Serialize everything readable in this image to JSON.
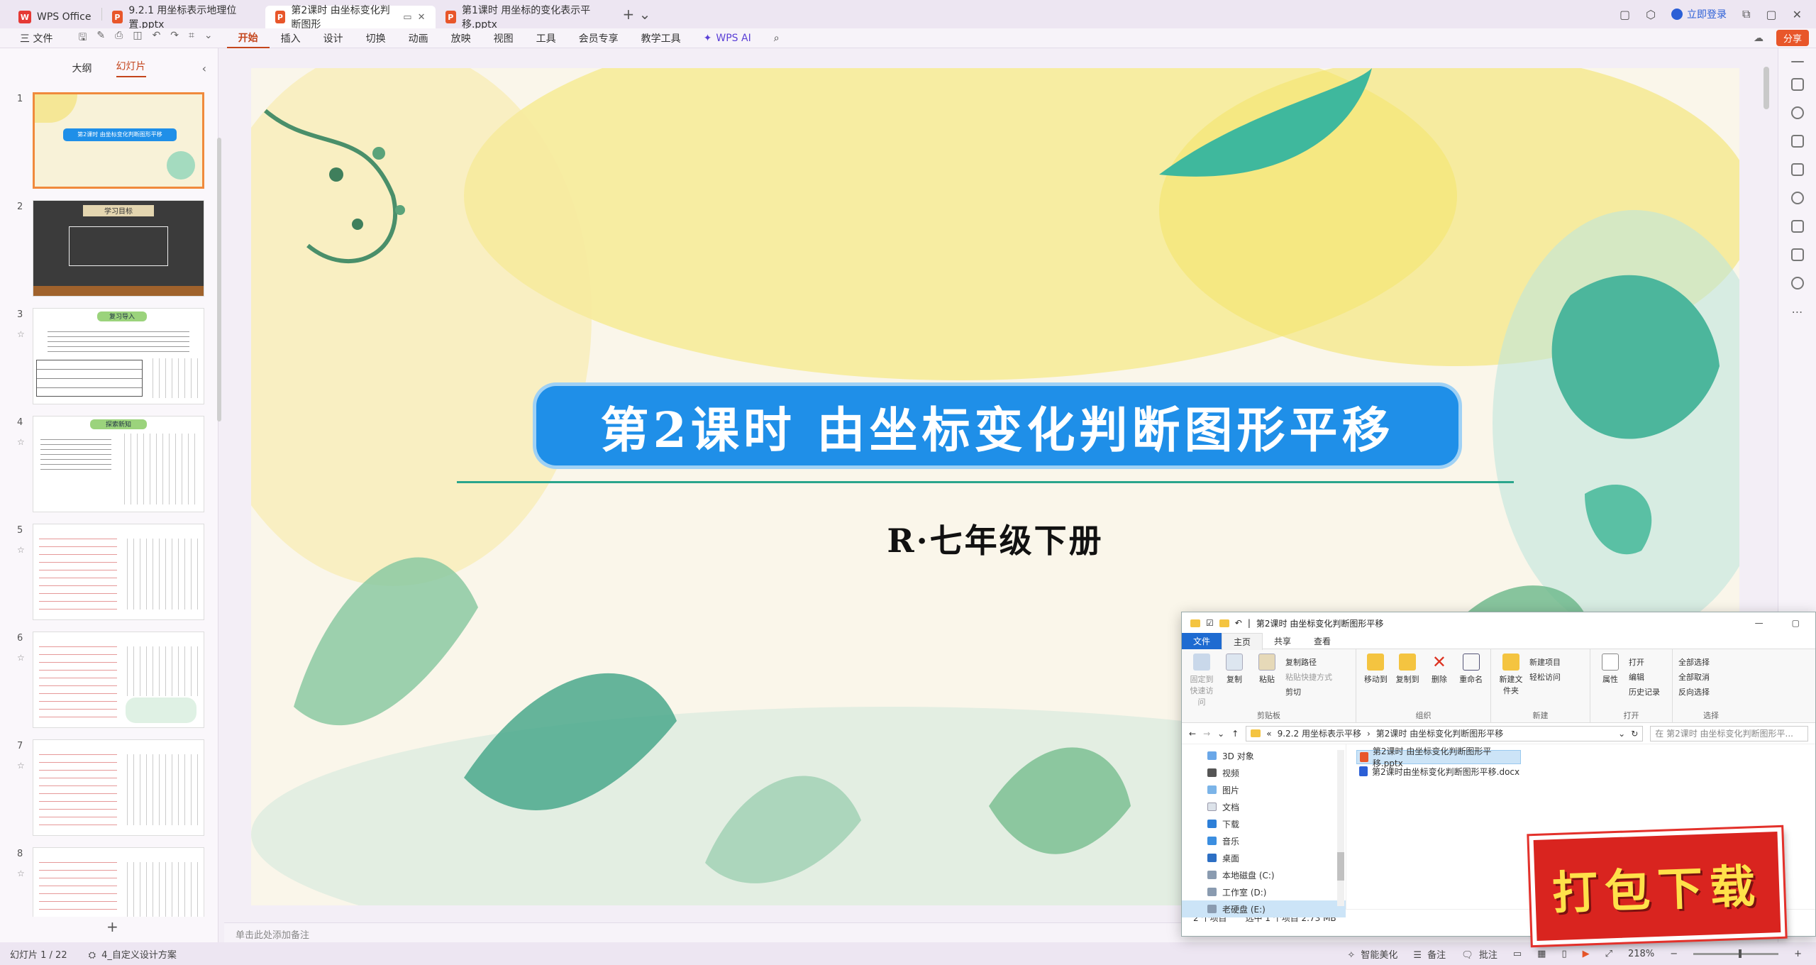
{
  "tabs": [
    {
      "label": "WPS Office",
      "logo": "W",
      "color": "#e53935"
    },
    {
      "label": "9.2.1 用坐标表示地理位置.pptx",
      "logo": "P",
      "color": "#e8562a"
    },
    {
      "label": "第2课时 由坐标变化判断图形",
      "logo": "P",
      "color": "#e8562a"
    },
    {
      "label": "第1课时 用坐标的变化表示平移.pptx",
      "logo": "P",
      "color": "#e8562a"
    }
  ],
  "login_label": "立即登录",
  "menu": {
    "file_label": "三 文件",
    "items": [
      "开始",
      "插入",
      "设计",
      "切换",
      "动画",
      "放映",
      "视图",
      "工具",
      "会员专享",
      "教学工具"
    ],
    "ai_label": "WPS AI",
    "share_label": "分享"
  },
  "left_pane": {
    "tab_outline": "大纲",
    "tab_slides": "幻灯片",
    "thumbnails": [
      {
        "num": "1",
        "caption": "第2课时 由坐标变化判断图形平移"
      },
      {
        "num": "2",
        "caption": "学习目标"
      },
      {
        "num": "3",
        "caption": "复习导入"
      },
      {
        "num": "4",
        "caption": "探索新知"
      },
      {
        "num": "5",
        "caption": ""
      },
      {
        "num": "6",
        "caption": ""
      },
      {
        "num": "7",
        "caption": ""
      },
      {
        "num": "8",
        "caption": ""
      }
    ]
  },
  "slide": {
    "title": "第2课时   由坐标变化判断图形平移",
    "subtitle": "R·七年级下册"
  },
  "notes_placeholder": "单击此处添加备注",
  "status": {
    "slide_counter": "幻灯片 1 / 22",
    "theme": "4_自定义设计方案",
    "beautify": "智能美化",
    "notes": "备注",
    "comments": "批注",
    "zoom": "218%",
    "zoom_fraction": 0.55
  },
  "explorer": {
    "title": "第2课时 由坐标变化判断图形平移",
    "tabs": [
      "文件",
      "主页",
      "共享",
      "查看"
    ],
    "ribbon": {
      "clipboard": {
        "label": "剪贴板",
        "pin": "固定到快速访问",
        "copy": "复制",
        "paste": "粘贴",
        "copy_path": "复制路径",
        "paste_shortcut": "粘贴快捷方式",
        "cut": "剪切"
      },
      "organize": {
        "label": "组织",
        "move_to": "移动到",
        "copy_to": "复制到",
        "delete": "删除",
        "rename": "重命名"
      },
      "new": {
        "label": "新建",
        "new_folder": "新建文件夹",
        "new_item": "新建项目",
        "easy_access": "轻松访问"
      },
      "open": {
        "label": "打开",
        "properties": "属性",
        "open": "打开",
        "edit": "编辑",
        "history": "历史记录"
      },
      "select": {
        "label": "选择",
        "select_all": "全部选择",
        "select_none": "全部取消",
        "invert": "反向选择"
      }
    },
    "address": [
      "9.2.2 用坐标表示平移",
      "第2课时 由坐标变化判断图形平移"
    ],
    "search_placeholder": "在 第2课时 由坐标变化判断图形平...",
    "nav": [
      "3D 对象",
      "视频",
      "图片",
      "文档",
      "下载",
      "音乐",
      "桌面",
      "本地磁盘 (C:)",
      "工作室 (D:)",
      "老硬盘 (E:)"
    ],
    "files": [
      "第2课时 由坐标变化判断图形平移.pptx",
      "第2课时由坐标变化判断图形平移.docx"
    ],
    "status_count": "2 个项目",
    "status_selected": "选中 1 个项目  2.73 MB"
  },
  "download_badge": "打包下载"
}
